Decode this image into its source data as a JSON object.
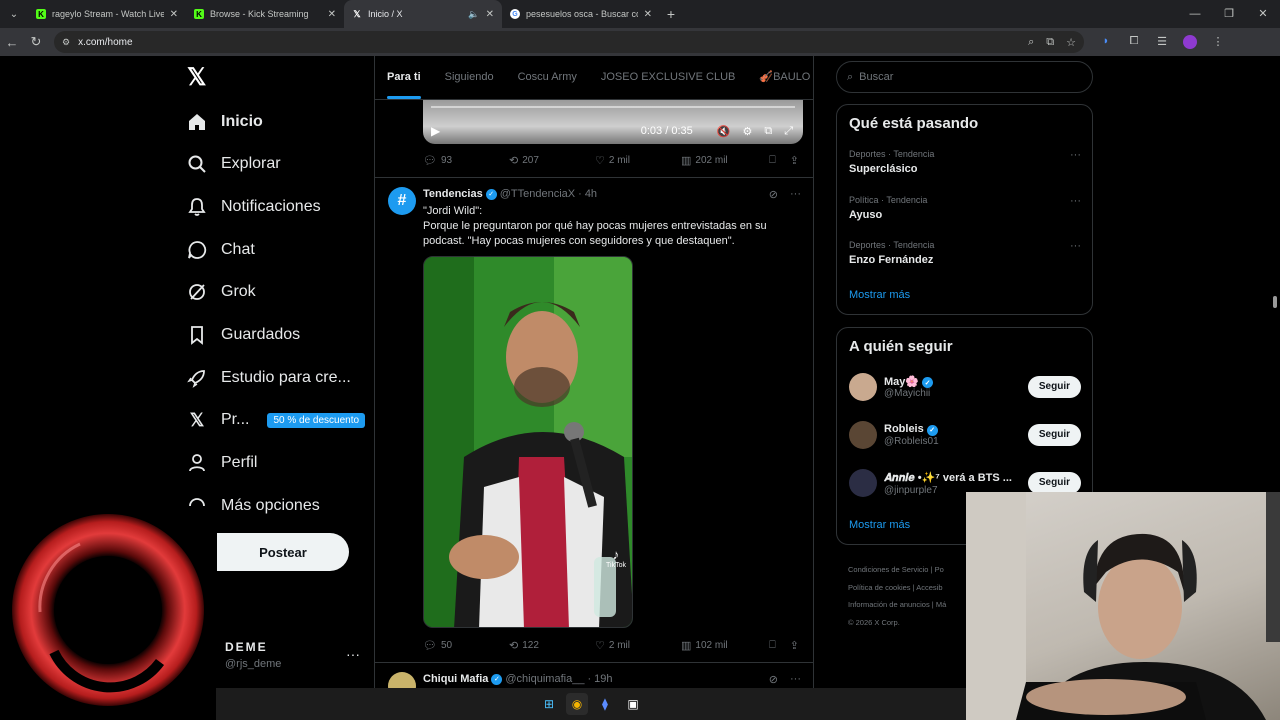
{
  "browser": {
    "tabs": [
      {
        "label": "rageylo Stream - Watch Live on",
        "favicon": "kick-icon"
      },
      {
        "label": "Browse - Kick Streaming",
        "favicon": "kick-icon"
      },
      {
        "label": "Inicio / X",
        "favicon": "x-icon"
      },
      {
        "label": "pesesuelos osca - Buscar con G",
        "favicon": "google-icon"
      }
    ],
    "active_tab": 2,
    "url": "x.com/home"
  },
  "sidebar": {
    "items": [
      {
        "label": "Inicio",
        "icon": "home-icon"
      },
      {
        "label": "Explorar",
        "icon": "search-icon"
      },
      {
        "label": "Notificaciones",
        "icon": "bell-icon"
      },
      {
        "label": "Chat",
        "icon": "chat-icon"
      },
      {
        "label": "Grok",
        "icon": "grok-icon"
      },
      {
        "label": "Guardados",
        "icon": "bookmark-icon"
      },
      {
        "label": "Estudio para cre...",
        "icon": "rocket-icon"
      },
      {
        "label": "Pr...",
        "icon": "x-icon"
      },
      {
        "label": "Perfil",
        "icon": "person-icon"
      },
      {
        "label": "Más opciones",
        "icon": "more-circle-icon"
      }
    ],
    "premium_badge": "50 % de descuento",
    "post_button": "Postear",
    "account": {
      "name": "DEME",
      "handle": "@rjs_deme"
    }
  },
  "feed": {
    "tabs": [
      "Para ti",
      "Siguiendo",
      "Coscu Army",
      "JOSEO EXCLUSIVE CLUB",
      "🎻BAULO C"
    ],
    "video": {
      "time": "0:03 / 0:35"
    },
    "post1_actions": {
      "replies": "93",
      "reposts": "207",
      "likes": "2 mil",
      "views": "202 mil"
    },
    "post2": {
      "author": "Tendencias",
      "handle": "@TTendenciaX",
      "time": "· 4h",
      "text_line1": "\"Jordi Wild\":",
      "text_line2": "Porque le preguntaron por qué hay pocas mujeres entrevistadas en su",
      "text_line3": "podcast. \"Hay pocas mujeres con seguidores y que destaquen\".",
      "media_watermark": "TikTok",
      "actions": {
        "replies": "50",
        "reposts": "122",
        "likes": "2 mil",
        "views": "102 mil"
      }
    },
    "post3": {
      "author": "Chiqui Mafia",
      "handle": "@chiquimafia__",
      "time": "· 19h"
    }
  },
  "right": {
    "search_placeholder": "Buscar",
    "trends_title": "Qué está pasando",
    "trends": [
      {
        "meta": "Deportes · Tendencia",
        "name": "Superclásico"
      },
      {
        "meta": "Política · Tendencia",
        "name": "Ayuso"
      },
      {
        "meta": "Deportes · Tendencia",
        "name": "Enzo Fernández"
      }
    ],
    "show_more": "Mostrar más",
    "follow_title": "A quién seguir",
    "follow": [
      {
        "name": "May🌸",
        "handle": "@Mayichii",
        "button": "Seguir",
        "avatar_color": "#c9a98f"
      },
      {
        "name": "Robleis",
        "handle": "@Robleis01",
        "button": "Seguir",
        "avatar_color": "#5a4634"
      },
      {
        "name": "𝑨𝒏𝒏𝒊𝒆 •✨⁷ verá a BTS ...",
        "handle": "@jinpurple7",
        "button": "Seguir",
        "avatar_color": "#2b2d44"
      }
    ],
    "follow_more": "Mostrar más",
    "footer": [
      "Condiciones de Servicio  |  Po",
      "Política de cookies  |  Accesib",
      "Información de anuncios  |  Má",
      "© 2026 X Corp."
    ]
  }
}
